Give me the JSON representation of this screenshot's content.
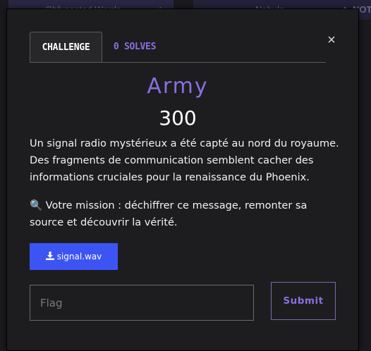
{
  "background": {
    "left_card_text": "Obfuscated Words",
    "right_card_text": "Nebula",
    "right_card_tag": "NOTE"
  },
  "modal": {
    "tabs": [
      {
        "label": "CHALLENGE",
        "active": true
      },
      {
        "label": "0 SOLVES",
        "active": false
      }
    ],
    "close_symbol": "×",
    "challenge": {
      "name": "Army",
      "value": "300",
      "description": [
        "Un signal radio mystérieux a été capté au nord du royaume. Des fragments de communication semblent cacher des informations cruciales pour la renaissance du Phoenix.",
        "🔍 Votre mission : déchiffrer ce message, remonter sa source et découvrir la vérité."
      ],
      "file": {
        "name": "signal.wav",
        "icon": "download-icon"
      }
    },
    "flag_input": {
      "placeholder": "Flag",
      "value": ""
    },
    "submit_label": "Submit"
  },
  "colors": {
    "accent": "#8a6fe0",
    "download_button": "#3d54f5",
    "modal_bg": "#1d1d1f"
  }
}
